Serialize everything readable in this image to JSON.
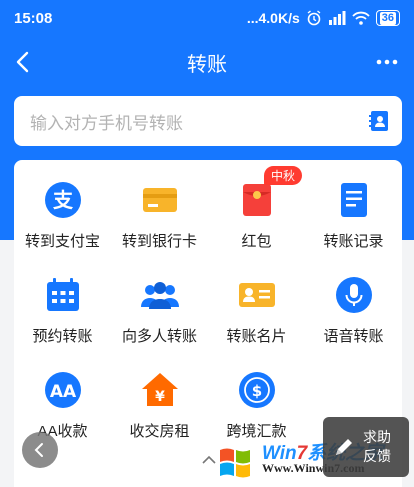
{
  "status_bar": {
    "time": "15:08",
    "network_speed": "...4.0K/s",
    "battery": "36"
  },
  "nav": {
    "title": "转账",
    "back_icon": "chevron-left-icon",
    "more_icon": "more-dots-icon"
  },
  "search": {
    "placeholder": "输入对方手机号转账",
    "contact_icon": "contact-book-icon"
  },
  "grid": {
    "items": [
      {
        "label": "转到支付宝",
        "icon": "alipay-icon"
      },
      {
        "label": "转到银行卡",
        "icon": "bank-card-icon"
      },
      {
        "label": "红包",
        "icon": "red-packet-icon",
        "badge": "中秋"
      },
      {
        "label": "转账记录",
        "icon": "transfer-record-icon"
      },
      {
        "label": "预约转账",
        "icon": "calendar-icon"
      },
      {
        "label": "向多人转账",
        "icon": "group-people-icon"
      },
      {
        "label": "转账名片",
        "icon": "business-card-icon"
      },
      {
        "label": "语音转账",
        "icon": "microphone-icon"
      },
      {
        "label": "AA收款",
        "icon": "aa-collect-icon"
      },
      {
        "label": "收交房租",
        "icon": "house-rent-icon"
      },
      {
        "label": "跨境汇款",
        "icon": "cross-border-remit-icon"
      }
    ]
  },
  "floating": {
    "feedback_line1": "求助",
    "feedback_line2": "反馈"
  },
  "watermark": {
    "title_a": "Win",
    "title_b": "7",
    "title_c": "系统之家",
    "url": "Www.Winwin7.com"
  },
  "colors": {
    "brand_blue": "#1677ff",
    "red_badge": "#ff3b30",
    "orange": "#ff6a00",
    "yellow": "#f8b42a"
  }
}
